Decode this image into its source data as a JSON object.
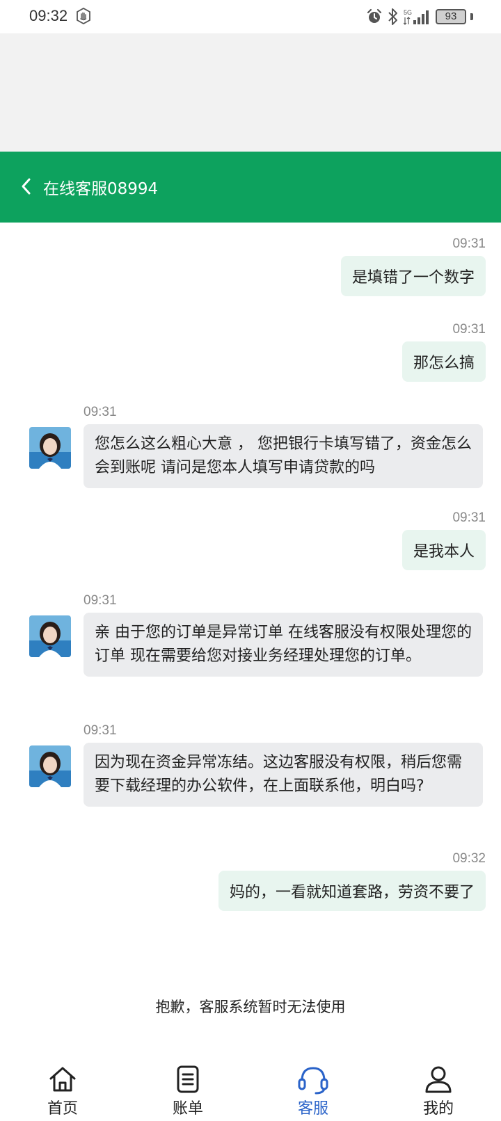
{
  "status_bar": {
    "time": "09:32",
    "network": "5G",
    "battery": "93"
  },
  "header": {
    "title": "在线客服08994"
  },
  "messages": [
    {
      "side": "right",
      "time": "09:31",
      "text": "是填错了一个数字"
    },
    {
      "side": "right",
      "time": "09:31",
      "text": "那怎么搞"
    },
    {
      "side": "left",
      "time": "09:31",
      "text": "您怎么这么粗心大意 ， 您把银行卡填写错了，资金怎么会到账呢 请问是您本人填写申请贷款的吗"
    },
    {
      "side": "right",
      "time": "09:31",
      "text": "是我本人"
    },
    {
      "side": "left",
      "time": "09:31",
      "text": "亲 由于您的订单是异常订单 在线客服没有权限处理您的订单 现在需要给您对接业务经理处理您的订单。"
    },
    {
      "side": "left",
      "time": "09:31",
      "text": "因为现在资金异常冻结。这边客服没有权限，稍后您需要下载经理的办公软件，在上面联系他，明白吗?"
    },
    {
      "side": "right",
      "time": "09:32",
      "text": "妈的，一看就知道套路，劳资不要了"
    }
  ],
  "notice": "抱歉，客服系统暂时无法使用",
  "tabs": [
    {
      "label": "首页",
      "icon": "home-icon",
      "active": false
    },
    {
      "label": "账单",
      "icon": "bill-icon",
      "active": false
    },
    {
      "label": "客服",
      "icon": "headset-icon",
      "active": true
    },
    {
      "label": "我的",
      "icon": "user-icon",
      "active": false
    }
  ],
  "colors": {
    "header_bg": "#0da25e",
    "active_tab": "#2a63c9",
    "bubble_right": "#e8f5ef",
    "bubble_left": "#ebecee"
  }
}
